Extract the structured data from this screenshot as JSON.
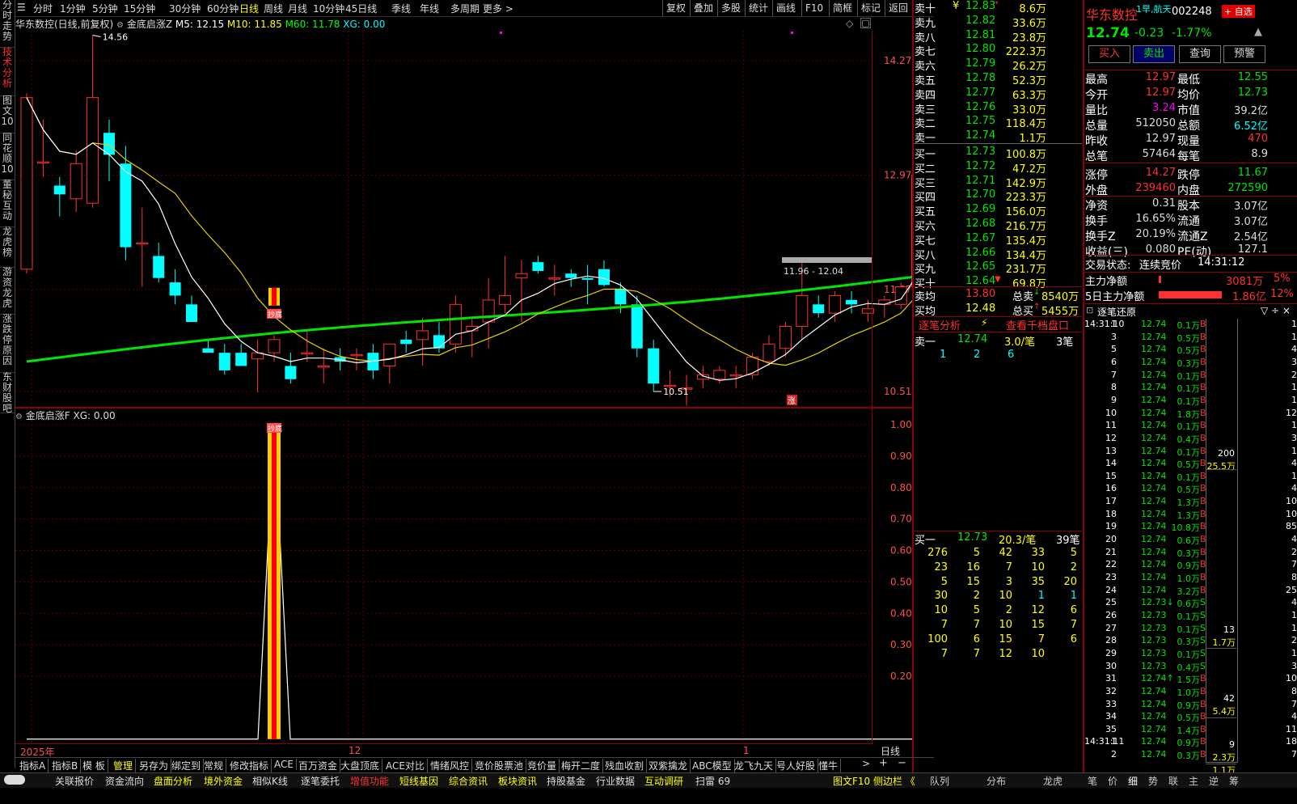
{
  "left_tabs": [
    {
      "label": "分时走势",
      "active": false
    },
    {
      "label": "技术分析",
      "active": true
    },
    {
      "label": "图文10",
      "active": false
    },
    {
      "label": "同花顺10",
      "active": false
    },
    {
      "label": "董秘互动",
      "active": false
    },
    {
      "label": "龙虎榜",
      "active": false
    },
    {
      "label": "游资龙虎",
      "active": false
    },
    {
      "label": "涨跌停原因",
      "active": false
    },
    {
      "label": "东财股吧",
      "active": false
    }
  ],
  "periods": [
    "分时",
    "1分钟",
    "5分钟",
    "15分钟",
    "30分钟",
    "60分钟",
    "日线",
    "周线",
    "月线",
    "10分钟",
    "45日线",
    "季线",
    "年线",
    "多周期",
    "更多 >"
  ],
  "active_period": "日线",
  "toolbar_right": [
    "复权",
    "叠加",
    "多股",
    "统计",
    "画线",
    "F10",
    "简框",
    "标记",
    "返回"
  ],
  "chart": {
    "title": "华东数控(日线,前复权)",
    "indicator": "金底启涨Z",
    "m5": "M5: 12.15",
    "m10": "M10: 11.85",
    "m60": "M60: 11.78",
    "xg": "XG: 0.00",
    "y_labels": [
      "14.27",
      "12.97",
      "11.67",
      "10.51"
    ],
    "high_label": "14.56",
    "low_label": "10.51",
    "range_label": "11.96 - 12.04",
    "up_mark": "涨",
    "sub_title": "金底启涨F XG: 0.00",
    "sub_y_labels": [
      "1.00",
      "0.90",
      "0.80",
      "0.70",
      "0.60",
      "0.50",
      "0.40",
      "0.30",
      "0.20"
    ],
    "x_labels": [
      "2025年",
      "12",
      "1"
    ],
    "period_badge": "日线",
    "signal_label": "抄底",
    "plus": "+",
    "minus": "−"
  },
  "chart_data": {
    "type": "candlestick",
    "ylim": [
      10.3,
      15.0
    ],
    "candles": [
      {
        "o": 11.9,
        "h": 13.9,
        "l": 11.85,
        "c": 13.85
      },
      {
        "o": 13.12,
        "h": 13.6,
        "l": 12.95,
        "c": 13.12
      },
      {
        "o": 12.85,
        "h": 12.95,
        "l": 12.5,
        "c": 12.75
      },
      {
        "o": 12.7,
        "h": 13.25,
        "l": 12.55,
        "c": 13.1
      },
      {
        "o": 12.65,
        "h": 14.56,
        "l": 12.6,
        "c": 13.85
      },
      {
        "o": 13.45,
        "h": 13.6,
        "l": 12.9,
        "c": 13.2
      },
      {
        "o": 13.1,
        "h": 13.3,
        "l": 12.0,
        "c": 12.15
      },
      {
        "o": 12.2,
        "h": 12.6,
        "l": 11.7,
        "c": 12.2
      },
      {
        "o": 12.05,
        "h": 12.2,
        "l": 11.75,
        "c": 11.8
      },
      {
        "o": 11.75,
        "h": 11.9,
        "l": 11.5,
        "c": 11.6
      },
      {
        "o": 11.5,
        "h": 11.6,
        "l": 11.3,
        "c": 11.3
      },
      {
        "o": 11.0,
        "h": 11.1,
        "l": 10.95,
        "c": 10.95
      },
      {
        "o": 10.95,
        "h": 11.05,
        "l": 10.7,
        "c": 10.75
      },
      {
        "o": 10.95,
        "h": 11.05,
        "l": 10.8,
        "c": 10.8
      },
      {
        "o": 10.88,
        "h": 11.1,
        "l": 10.5,
        "c": 10.95
      },
      {
        "o": 10.95,
        "h": 11.15,
        "l": 10.85,
        "c": 11.1
      },
      {
        "o": 10.8,
        "h": 10.95,
        "l": 10.6,
        "c": 10.65
      },
      {
        "o": 10.95,
        "h": 11.2,
        "l": 10.85,
        "c": 10.95
      },
      {
        "o": 10.8,
        "h": 11.0,
        "l": 10.6,
        "c": 10.8
      },
      {
        "o": 10.9,
        "h": 11.0,
        "l": 10.75,
        "c": 10.85
      },
      {
        "o": 10.93,
        "h": 11.0,
        "l": 10.75,
        "c": 10.93
      },
      {
        "o": 10.95,
        "h": 11.05,
        "l": 10.65,
        "c": 10.75
      },
      {
        "o": 10.8,
        "h": 11.05,
        "l": 10.6,
        "c": 11.05
      },
      {
        "o": 11.1,
        "h": 11.2,
        "l": 10.95,
        "c": 11.05
      },
      {
        "o": 11.1,
        "h": 11.35,
        "l": 10.8,
        "c": 11.2
      },
      {
        "o": 11.15,
        "h": 11.3,
        "l": 10.95,
        "c": 11.0
      },
      {
        "o": 11.05,
        "h": 11.6,
        "l": 10.95,
        "c": 11.5
      },
      {
        "o": 11.2,
        "h": 11.35,
        "l": 10.9,
        "c": 11.25
      },
      {
        "o": 11.3,
        "h": 11.8,
        "l": 11.0,
        "c": 11.55
      },
      {
        "o": 11.5,
        "h": 12.05,
        "l": 11.4,
        "c": 11.6
      },
      {
        "o": 11.8,
        "h": 12.0,
        "l": 11.3,
        "c": 11.85
      },
      {
        "o": 11.98,
        "h": 12.05,
        "l": 11.85,
        "c": 11.88
      },
      {
        "o": 11.8,
        "h": 11.95,
        "l": 11.6,
        "c": 11.8
      },
      {
        "o": 11.85,
        "h": 11.9,
        "l": 11.7,
        "c": 11.8
      },
      {
        "o": 11.8,
        "h": 11.95,
        "l": 11.5,
        "c": 11.78
      },
      {
        "o": 11.9,
        "h": 12.0,
        "l": 11.7,
        "c": 11.72
      },
      {
        "o": 11.68,
        "h": 11.75,
        "l": 11.4,
        "c": 11.5
      },
      {
        "o": 11.5,
        "h": 11.6,
        "l": 10.9,
        "c": 11.0
      },
      {
        "o": 11.0,
        "h": 11.1,
        "l": 10.51,
        "c": 10.6
      },
      {
        "o": 10.58,
        "h": 10.75,
        "l": 10.45,
        "c": 10.58
      },
      {
        "o": 10.55,
        "h": 10.7,
        "l": 10.35,
        "c": 10.55
      },
      {
        "o": 10.65,
        "h": 10.8,
        "l": 10.55,
        "c": 10.7
      },
      {
        "o": 10.65,
        "h": 10.8,
        "l": 10.6,
        "c": 10.75
      },
      {
        "o": 10.7,
        "h": 10.8,
        "l": 10.55,
        "c": 10.7
      },
      {
        "o": 10.7,
        "h": 10.95,
        "l": 10.65,
        "c": 10.9
      },
      {
        "o": 10.85,
        "h": 11.15,
        "l": 10.8,
        "c": 11.05
      },
      {
        "o": 11.0,
        "h": 11.3,
        "l": 10.9,
        "c": 11.25
      },
      {
        "o": 11.25,
        "h": 12.0,
        "l": 11.1,
        "c": 11.6
      },
      {
        "o": 11.5,
        "h": 11.6,
        "l": 11.35,
        "c": 11.4
      },
      {
        "o": 11.4,
        "h": 11.65,
        "l": 11.3,
        "c": 11.6
      },
      {
        "o": 11.55,
        "h": 11.65,
        "l": 11.4,
        "c": 11.5
      },
      {
        "o": 11.4,
        "h": 11.55,
        "l": 11.3,
        "c": 11.45
      },
      {
        "o": 11.5,
        "h": 11.6,
        "l": 11.35,
        "c": 11.55
      },
      {
        "o": 11.5,
        "h": 11.75,
        "l": 11.45,
        "c": 11.7
      },
      {
        "o": 11.7,
        "h": 12.97,
        "l": 11.65,
        "c": 12.97
      },
      {
        "o": 12.97,
        "h": 12.97,
        "l": 12.55,
        "c": 12.74
      }
    ],
    "signal_index": 15,
    "sub_ylim": [
      0,
      1
    ]
  },
  "sell_levels": [
    {
      "label": "卖十",
      "price": "12.83",
      "vol": "8.6万",
      "mark": "*"
    },
    {
      "label": "卖九",
      "price": "12.82",
      "vol": "33.6万",
      "mark": ""
    },
    {
      "label": "卖八",
      "price": "12.81",
      "vol": "23.8万",
      "mark": ""
    },
    {
      "label": "卖七",
      "price": "12.80",
      "vol": "222.3万",
      "mark": ""
    },
    {
      "label": "卖六",
      "price": "12.79",
      "vol": "26.2万",
      "mark": ""
    },
    {
      "label": "卖五",
      "price": "12.78",
      "vol": "52.3万",
      "mark": ""
    },
    {
      "label": "卖四",
      "price": "12.77",
      "vol": "63.3万",
      "mark": ""
    },
    {
      "label": "卖三",
      "price": "12.76",
      "vol": "33.0万",
      "mark": ""
    },
    {
      "label": "卖二",
      "price": "12.75",
      "vol": "118.4万",
      "mark": ""
    },
    {
      "label": "卖一",
      "price": "12.74",
      "vol": "1.1万",
      "mark": ""
    }
  ],
  "sell_currency": "¥",
  "buy_levels": [
    {
      "label": "买一",
      "price": "12.73",
      "vol": "100.8万",
      "mark": ""
    },
    {
      "label": "买二",
      "price": "12.72",
      "vol": "47.2万",
      "mark": ""
    },
    {
      "label": "买三",
      "price": "12.71",
      "vol": "142.9万",
      "mark": ""
    },
    {
      "label": "买四",
      "price": "12.70",
      "vol": "223.3万",
      "mark": ""
    },
    {
      "label": "买五",
      "price": "12.69",
      "vol": "156.0万",
      "mark": ""
    },
    {
      "label": "买六",
      "price": "12.68",
      "vol": "216.7万",
      "mark": ""
    },
    {
      "label": "买七",
      "price": "12.67",
      "vol": "135.4万",
      "mark": ""
    },
    {
      "label": "买八",
      "price": "12.66",
      "vol": "134.4万",
      "mark": ""
    },
    {
      "label": "买九",
      "price": "12.65",
      "vol": "231.7万",
      "mark": ""
    },
    {
      "label": "买十",
      "price": "12.64",
      "vol": "69.8万",
      "mark": "▼"
    }
  ],
  "avg": {
    "sell_label": "卖均",
    "sell_price": "13.80",
    "total_sell_label": "总卖",
    "total_sell": "8540万",
    "buy_label": "买均",
    "buy_price": "12.48",
    "total_buy_label": "总买",
    "total_buy": "5455万"
  },
  "tick_analysis": {
    "title": "逐笔分析",
    "lightning": "⚡",
    "link": "查看千档盘口",
    "sell1_label": "卖一",
    "sell1_price": "12.74",
    "sell1_avg": "3.0/笔",
    "sell1_count": "3笔",
    "sell1_orders": [
      "1",
      "2",
      "6"
    ],
    "buy1_label": "买一",
    "buy1_price": "12.73",
    "buy1_avg": "20.3/笔",
    "buy1_count": "39笔",
    "buy1_orders": [
      [
        "276",
        "5",
        "42",
        "33",
        "5"
      ],
      [
        "23",
        "16",
        "7",
        "10",
        "2"
      ],
      [
        "5",
        "15",
        "3",
        "35",
        "20"
      ],
      [
        "30",
        "2",
        "10",
        "1",
        "1"
      ],
      [
        "10",
        "5",
        "2",
        "12",
        "6"
      ],
      [
        "7",
        "7",
        "10",
        "15",
        "7"
      ],
      [
        "100",
        "6",
        "15",
        "7",
        "6"
      ],
      [
        "7",
        "7",
        "12",
        "10",
        ""
      ]
    ]
  },
  "stock": {
    "name": "华东数控",
    "concept": "1早,航天",
    "code": "002248",
    "add_button": "+ 自选",
    "price": "12.74",
    "change": "-0.23",
    "change_pct": "-1.77%",
    "buy_btn": "买入",
    "sell_btn": "卖出",
    "query_btn": "查询",
    "alert_btn": "预警"
  },
  "quote": [
    [
      "最高",
      "12.97",
      "最低",
      "12.55"
    ],
    [
      "今开",
      "12.97",
      "均价",
      "12.73"
    ],
    [
      "量比",
      "3.24",
      "市值",
      "39.2亿"
    ],
    [
      "总量",
      "512050",
      "总额",
      "6.52亿"
    ],
    [
      "昨收",
      "12.97",
      "现量",
      "470"
    ],
    [
      "总笔",
      "57464",
      "每笔",
      "8.9"
    ],
    [
      "涨停",
      "14.27",
      "跌停",
      "11.67"
    ],
    [
      "外盘",
      "239460",
      "内盘",
      "272590"
    ],
    [
      "净资",
      "0.31",
      "股本",
      "3.07亿"
    ],
    [
      "换手",
      "16.65%",
      "流通",
      "3.07亿"
    ],
    [
      "换手Z",
      "20.19%",
      "流通Z",
      "2.54亿"
    ],
    [
      "收益(三)",
      "0.080",
      "PE(动)",
      "127.1"
    ]
  ],
  "trade_status_label": "交易状态:",
  "trade_status": "连续竞价",
  "trade_time": "14:31:12",
  "main_flow": {
    "label": "主力净额",
    "value": "3081万",
    "pct": "5%"
  },
  "main_flow5": {
    "label": "5日主力净额",
    "value": "1.86亿",
    "pct": "12%"
  },
  "tick_panel": {
    "title": "逐笔还原",
    "controls": "▽ ÷ ×"
  },
  "ticks": [
    {
      "t": "14:31:10",
      "n": "1",
      "p": "12.74",
      "v": "0.1万",
      "s": "B"
    },
    {
      "t": "",
      "n": "3",
      "p": "12.74",
      "v": "0.5万",
      "s": "B"
    },
    {
      "t": "",
      "n": "5",
      "p": "12.74",
      "v": "0.5万",
      "s": "B"
    },
    {
      "t": "",
      "n": "6",
      "p": "12.74",
      "v": "0.3万",
      "s": "B"
    },
    {
      "t": "",
      "n": "7",
      "p": "12.74",
      "v": "0.1万",
      "s": "B"
    },
    {
      "t": "",
      "n": "8",
      "p": "12.74",
      "v": "0.1万",
      "s": "B"
    },
    {
      "t": "",
      "n": "9",
      "p": "12.74",
      "v": "0.1万",
      "s": "B"
    },
    {
      "t": "",
      "n": "10",
      "p": "12.74",
      "v": "1.8万",
      "s": "B"
    },
    {
      "t": "",
      "n": "11",
      "p": "12.74",
      "v": "0.1万",
      "s": "B"
    },
    {
      "t": "",
      "n": "12",
      "p": "12.74",
      "v": "0.4万",
      "s": "B"
    },
    {
      "t": "",
      "n": "13",
      "p": "12.74",
      "v": "0.1万",
      "s": "B"
    },
    {
      "t": "",
      "n": "14",
      "p": "12.74",
      "v": "0.5万",
      "s": "B"
    },
    {
      "t": "",
      "n": "15",
      "p": "12.74",
      "v": "0.1万",
      "s": "B"
    },
    {
      "t": "",
      "n": "16",
      "p": "12.74",
      "v": "0.5万",
      "s": "B"
    },
    {
      "t": "",
      "n": "17",
      "p": "12.74",
      "v": "1.3万",
      "s": "B"
    },
    {
      "t": "",
      "n": "18",
      "p": "12.74",
      "v": "1.3万",
      "s": "B"
    },
    {
      "t": "",
      "n": "19",
      "p": "12.74",
      "v": "10.8万",
      "s": "B"
    },
    {
      "t": "",
      "n": "20",
      "p": "12.74",
      "v": "0.6万",
      "s": "B"
    },
    {
      "t": "",
      "n": "21",
      "p": "12.74",
      "v": "0.3万",
      "s": "B"
    },
    {
      "t": "",
      "n": "22",
      "p": "12.74",
      "v": "0.9万",
      "s": "B"
    },
    {
      "t": "",
      "n": "23",
      "p": "12.74",
      "v": "1.0万",
      "s": "B"
    },
    {
      "t": "",
      "n": "24",
      "p": "12.74",
      "v": "3.2万",
      "s": "B"
    },
    {
      "t": "",
      "n": "25",
      "p": "12.73↓",
      "v": "0.6万",
      "s": "S"
    },
    {
      "t": "",
      "n": "26",
      "p": "12.73",
      "v": "0.1万",
      "s": "S"
    },
    {
      "t": "",
      "n": "27",
      "p": "12.73",
      "v": "0.1万",
      "s": "S"
    },
    {
      "t": "",
      "n": "28",
      "p": "12.73",
      "v": "0.3万",
      "s": "S"
    },
    {
      "t": "",
      "n": "29",
      "p": "12.73",
      "v": "0.1万",
      "s": "S"
    },
    {
      "t": "",
      "n": "30",
      "p": "12.73",
      "v": "0.4万",
      "s": "S"
    },
    {
      "t": "",
      "n": "31",
      "p": "12.74↑",
      "v": "1.5万",
      "s": "B"
    },
    {
      "t": "",
      "n": "32",
      "p": "12.74",
      "v": "1.0万",
      "s": "B"
    },
    {
      "t": "",
      "n": "33",
      "p": "12.74",
      "v": "0.9万",
      "s": "B"
    },
    {
      "t": "",
      "n": "34",
      "p": "12.74",
      "v": "0.5万",
      "s": "B"
    },
    {
      "t": "",
      "n": "35",
      "p": "12.74",
      "v": "1.4万",
      "s": "B"
    },
    {
      "t": "14:31:11",
      "n": "1",
      "p": "12.74",
      "v": "0.9万",
      "s": "B"
    },
    {
      "t": "",
      "n": "2",
      "p": "12.74",
      "v": "0.3万",
      "s": "B"
    }
  ],
  "tick_groups": [
    {
      "count": "200",
      "vol": "25.5万"
    },
    {
      "count": "13",
      "vol": "1.7万"
    },
    {
      "count": "42",
      "vol": "5.4万"
    },
    {
      "count": "9",
      "vol": "2.3万"
    },
    {
      "count": "",
      "vol": "1.1万"
    }
  ],
  "tick_right": [
    "1",
    "1",
    "4",
    "3",
    "2",
    "1",
    "1",
    "12",
    "1",
    "3",
    "1",
    "4",
    "1",
    "4",
    "10",
    "10",
    "85",
    "4",
    "2",
    "7",
    "8",
    "25",
    "4",
    "1",
    "1",
    "2",
    "1",
    "3",
    "10",
    "8",
    "7",
    "4",
    "11",
    "18",
    "7",
    "2"
  ],
  "bottom_tabs": [
    "指标A",
    "指标B",
    "模 板",
    "管理",
    "另存为",
    "绑定到",
    "常规",
    "修改指标",
    "ACE",
    "百万资金",
    "大盘顶底",
    "ACE对比",
    "情绪风控",
    "竞价股票池",
    "竞价量",
    "梅开二度",
    "残血收割",
    "双紫擒龙",
    "ABC模型",
    "龙飞九天",
    "号人好股",
    "懂牛"
  ],
  "active_bottom_tab": "管理",
  "status_items": [
    {
      "label": "关联报价",
      "color": "#ddd"
    },
    {
      "label": "资金流向",
      "color": "#ddd"
    },
    {
      "label": "盘面分析",
      "color": "#ffff00"
    },
    {
      "label": "境外资金",
      "color": "#ffff00"
    },
    {
      "label": "相似K线",
      "color": "#ddd"
    },
    {
      "label": "逐笔委托",
      "color": "#ddd"
    },
    {
      "label": "增值功能",
      "color": "#ff3030"
    },
    {
      "label": "短线基因",
      "color": "#ffff00"
    },
    {
      "label": "综合资讯",
      "color": "#ffff00"
    },
    {
      "label": "板块资讯",
      "color": "#ffff00"
    },
    {
      "label": "持股基金",
      "color": "#ddd"
    },
    {
      "label": "行业数据",
      "color": "#ddd"
    },
    {
      "label": "互动调研",
      "color": "#ffff00"
    },
    {
      "label": "扫雷 69",
      "color": "#ddd"
    }
  ],
  "status_right": "图文F10 侧边栏 《",
  "right_tabs": [
    "队列",
    "分布",
    "龙虎",
    "笔",
    "价",
    "细",
    "势",
    "联",
    "主",
    "逆",
    "筹"
  ]
}
